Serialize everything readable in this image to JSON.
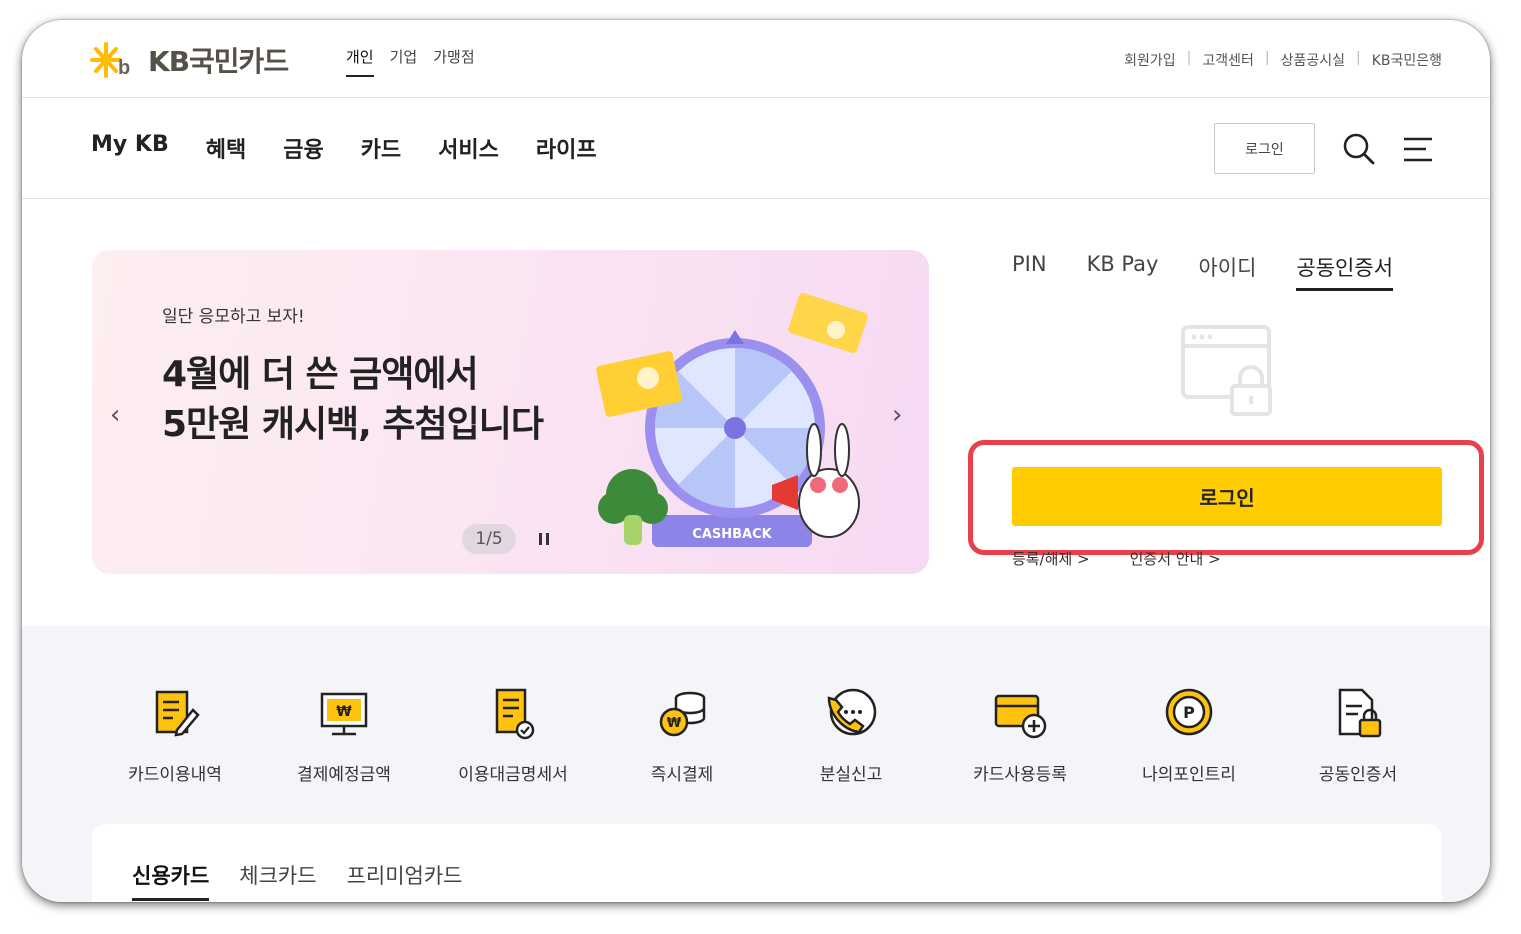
{
  "brand": {
    "name": "KB국민카드",
    "accent": "#ffcc00",
    "highlight": "#e8414d"
  },
  "segments": [
    "개인",
    "기업",
    "가맹점"
  ],
  "util_links": [
    "회원가입",
    "고객센터",
    "상품공시실",
    "KB국민은행"
  ],
  "gnb": [
    "My KB",
    "혜택",
    "금융",
    "카드",
    "서비스",
    "라이프"
  ],
  "header": {
    "login_label": "로그인"
  },
  "banner": {
    "subtitle": "일단 응모하고 보자!",
    "title_line1": "4월에 더 쓴 금액에서",
    "title_line2": "5만원 캐시백, 추첨입니다",
    "wheel_label": "CASHBACK",
    "pager": "1/5"
  },
  "auth": {
    "tabs": [
      "PIN",
      "KB Pay",
      "아이디",
      "공동인증서"
    ],
    "active_tab": "공동인증서",
    "login_label": "로그인",
    "links": [
      "등록/해제 >",
      "인증서 안내 >"
    ]
  },
  "quick_menu": [
    {
      "label": "카드이용내역",
      "icon": "card-history-icon"
    },
    {
      "label": "결제예정금액",
      "icon": "payment-due-icon"
    },
    {
      "label": "이용대금명세서",
      "icon": "statement-icon"
    },
    {
      "label": "즉시결제",
      "icon": "instant-pay-icon"
    },
    {
      "label": "분실신고",
      "icon": "lost-report-icon"
    },
    {
      "label": "카드사용등록",
      "icon": "card-register-icon"
    },
    {
      "label": "나의포인트리",
      "icon": "pointree-icon"
    },
    {
      "label": "공동인증서",
      "icon": "certificate-icon"
    }
  ],
  "card_tabs": [
    "신용카드",
    "체크카드",
    "프리미엄카드"
  ]
}
